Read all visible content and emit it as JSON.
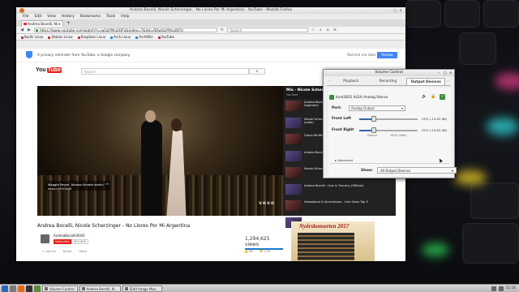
{
  "firefox": {
    "window_title": "Andrea Bocelli, Nicole Scherzinger - No Llores Por Mi Argentina - YouTube - Mozilla Firefox",
    "menu": [
      "File",
      "Edit",
      "View",
      "History",
      "Bookmarks",
      "Tools",
      "Help"
    ],
    "tab_label": "Andrea Bocelli, Ni",
    "new_tab": "+",
    "url": "https://www.youtube.com/watch?v=wGqYMcpJQFU&index=7&list=RDwGqYMcpJQFU",
    "search_placeholder": "Search",
    "bookmarks": [
      "Bodhi Linux",
      "Debian Linux",
      "Raspbian Linux",
      "Arch Linux",
      "ArchWiki",
      "YouTube"
    ]
  },
  "consent": {
    "text": "A privacy reminder from YouTube, a Google company",
    "remind": "Remind me later",
    "review": "Review"
  },
  "youtube": {
    "logo": "You",
    "logo_tube": "Tube",
    "search_placeholder": "Search",
    "overlay_text": "Maggie Reyes 'Abrazo ilimate watch'",
    "overlay_sub": "vevo.ly/Ch1kgS",
    "vevo": "vevo",
    "video_title": "Andrea Bocelli, Nicole Scherzinger - No Llores Por Mi Argentina",
    "channel": "AndreaBocelliVEVO",
    "subscribe": "Subscribe",
    "sub_count": "902,000",
    "views": "1,294,625 views",
    "actions": [
      "+ Add to",
      "Share",
      "More"
    ],
    "likes": [
      "6K",
      "116"
    ],
    "playlist": {
      "title": "Mix - Nicole Scherzinger",
      "sub": "YouTube",
      "items": [
        "Andrea Bocelli, Nicole Scherzinger - No Llores Por Mi Argentina",
        "Nicole Scherzinger - Somebody's Gonna Get Hurt (Official Audio)",
        "Gloria Whitfield - Don't Cry For Me Argentina",
        "Andrea Bocelli & Sarah Brightman",
        "Nicole Scherzinger Performs 'Inigo' XFactor",
        "Andrea Bocelli - Live in Tuscany (Official)",
        "Sebastiano & Scherzinger - Live Show Top 3",
        "The Best of Nicole Scherzinger - The X Factor UK 2012"
      ]
    },
    "ad_title": "Nyårskonserten 2017"
  },
  "volume_control": {
    "title": "Volume Control",
    "tabs": [
      "Playback",
      "Recording",
      "Output Devices"
    ],
    "prev": "‹",
    "next": "›",
    "device": "bcm2835 ALSA Analog Stereo",
    "port_label": "Port:",
    "port_value": "Analog Output",
    "front_left_label": "Front Left",
    "front_right_label": "Front Right",
    "front_left_value": "25% (-14.63 dB)",
    "front_right_value": "25% (-14.63 dB)",
    "front_left_level": 0.25,
    "front_right_level": 0.25,
    "tick_silence": "Silence",
    "tick_unamplified": "100% (0dB)",
    "advanced": "▸ Advanced",
    "show_label": "Show:",
    "show_value": "All Output Devices"
  },
  "taskbar": {
    "apps": [
      "Volume Control",
      "Andrea Bocelli, N...",
      "[Edit Image Mov..."
    ],
    "clock": "11:16"
  }
}
